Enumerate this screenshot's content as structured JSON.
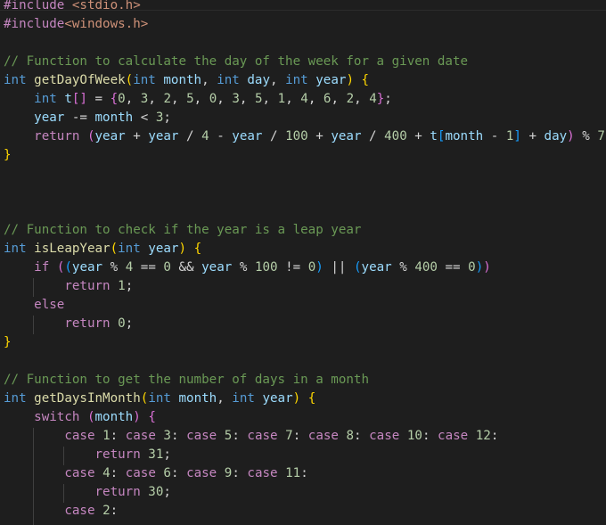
{
  "colors": {
    "background": "#1e1e1e",
    "keyword": "#569cd6",
    "control": "#c586c0",
    "function": "#dcdcaa",
    "variable": "#9cdcfe",
    "number": "#b5cea8",
    "string": "#ce9178",
    "comment": "#6a9955",
    "text": "#d4d4d4",
    "bracket_gold": "#ffd700",
    "bracket_purple": "#da70d6",
    "bracket_blue": "#179fff"
  },
  "lines": [
    [
      [
        "#include",
        "control"
      ],
      [
        " ",
        "text"
      ],
      [
        "<stdio.h>",
        "string"
      ]
    ],
    [
      [
        "#include",
        "control"
      ],
      [
        "<windows.h>",
        "string"
      ]
    ],
    [],
    [
      [
        "// Function to calculate the day of the week for a given date",
        "comment"
      ]
    ],
    [
      [
        "int",
        "keyword"
      ],
      [
        " ",
        "text"
      ],
      [
        "getDayOfWeek",
        "function"
      ],
      [
        "(",
        "bracket_gold"
      ],
      [
        "int",
        "keyword"
      ],
      [
        " ",
        "text"
      ],
      [
        "month",
        "variable"
      ],
      [
        ", ",
        "text"
      ],
      [
        "int",
        "keyword"
      ],
      [
        " ",
        "text"
      ],
      [
        "day",
        "variable"
      ],
      [
        ", ",
        "text"
      ],
      [
        "int",
        "keyword"
      ],
      [
        " ",
        "text"
      ],
      [
        "year",
        "variable"
      ],
      [
        ")",
        "bracket_gold"
      ],
      [
        " ",
        "text"
      ],
      [
        "{",
        "bracket_gold"
      ]
    ],
    [
      [
        "    ",
        "text"
      ],
      [
        "int",
        "keyword"
      ],
      [
        " ",
        "text"
      ],
      [
        "t",
        "variable"
      ],
      [
        "[]",
        "bracket_purple"
      ],
      [
        " = ",
        "text"
      ],
      [
        "{",
        "bracket_purple"
      ],
      [
        "0",
        "number"
      ],
      [
        ", ",
        "text"
      ],
      [
        "3",
        "number"
      ],
      [
        ", ",
        "text"
      ],
      [
        "2",
        "number"
      ],
      [
        ", ",
        "text"
      ],
      [
        "5",
        "number"
      ],
      [
        ", ",
        "text"
      ],
      [
        "0",
        "number"
      ],
      [
        ", ",
        "text"
      ],
      [
        "3",
        "number"
      ],
      [
        ", ",
        "text"
      ],
      [
        "5",
        "number"
      ],
      [
        ", ",
        "text"
      ],
      [
        "1",
        "number"
      ],
      [
        ", ",
        "text"
      ],
      [
        "4",
        "number"
      ],
      [
        ", ",
        "text"
      ],
      [
        "6",
        "number"
      ],
      [
        ", ",
        "text"
      ],
      [
        "2",
        "number"
      ],
      [
        ", ",
        "text"
      ],
      [
        "4",
        "number"
      ],
      [
        "}",
        "bracket_purple"
      ],
      [
        ";",
        "text"
      ]
    ],
    [
      [
        "    ",
        "text"
      ],
      [
        "year",
        "variable"
      ],
      [
        " -= ",
        "text"
      ],
      [
        "month",
        "variable"
      ],
      [
        " < ",
        "text"
      ],
      [
        "3",
        "number"
      ],
      [
        ";",
        "text"
      ]
    ],
    [
      [
        "    ",
        "text"
      ],
      [
        "return",
        "control"
      ],
      [
        " ",
        "text"
      ],
      [
        "(",
        "bracket_purple"
      ],
      [
        "year",
        "variable"
      ],
      [
        " + ",
        "text"
      ],
      [
        "year",
        "variable"
      ],
      [
        " / ",
        "text"
      ],
      [
        "4",
        "number"
      ],
      [
        " - ",
        "text"
      ],
      [
        "year",
        "variable"
      ],
      [
        " / ",
        "text"
      ],
      [
        "100",
        "number"
      ],
      [
        " + ",
        "text"
      ],
      [
        "year",
        "variable"
      ],
      [
        " / ",
        "text"
      ],
      [
        "400",
        "number"
      ],
      [
        " + ",
        "text"
      ],
      [
        "t",
        "variable"
      ],
      [
        "[",
        "bracket_blue"
      ],
      [
        "month",
        "variable"
      ],
      [
        " - ",
        "text"
      ],
      [
        "1",
        "number"
      ],
      [
        "]",
        "bracket_blue"
      ],
      [
        " + ",
        "text"
      ],
      [
        "day",
        "variable"
      ],
      [
        ")",
        "bracket_purple"
      ],
      [
        " % ",
        "text"
      ],
      [
        "7",
        "number"
      ],
      [
        ";",
        "text"
      ]
    ],
    [
      [
        "}",
        "bracket_gold"
      ]
    ],
    [],
    [],
    [],
    [
      [
        "// Function to check if the year is a leap year",
        "comment"
      ]
    ],
    [
      [
        "int",
        "keyword"
      ],
      [
        " ",
        "text"
      ],
      [
        "isLeapYear",
        "function"
      ],
      [
        "(",
        "bracket_gold"
      ],
      [
        "int",
        "keyword"
      ],
      [
        " ",
        "text"
      ],
      [
        "year",
        "variable"
      ],
      [
        ")",
        "bracket_gold"
      ],
      [
        " ",
        "text"
      ],
      [
        "{",
        "bracket_gold"
      ]
    ],
    [
      [
        "    ",
        "text"
      ],
      [
        "if",
        "control"
      ],
      [
        " ",
        "text"
      ],
      [
        "(",
        "bracket_purple"
      ],
      [
        "(",
        "bracket_blue"
      ],
      [
        "year",
        "variable"
      ],
      [
        " % ",
        "text"
      ],
      [
        "4",
        "number"
      ],
      [
        " == ",
        "text"
      ],
      [
        "0",
        "number"
      ],
      [
        " && ",
        "text"
      ],
      [
        "year",
        "variable"
      ],
      [
        " % ",
        "text"
      ],
      [
        "100",
        "number"
      ],
      [
        " != ",
        "text"
      ],
      [
        "0",
        "number"
      ],
      [
        ")",
        "bracket_blue"
      ],
      [
        " || ",
        "text"
      ],
      [
        "(",
        "bracket_blue"
      ],
      [
        "year",
        "variable"
      ],
      [
        " % ",
        "text"
      ],
      [
        "400",
        "number"
      ],
      [
        " == ",
        "text"
      ],
      [
        "0",
        "number"
      ],
      [
        ")",
        "bracket_blue"
      ],
      [
        ")",
        "bracket_purple"
      ]
    ],
    [
      [
        "        ",
        "text"
      ],
      [
        "return",
        "control"
      ],
      [
        " ",
        "text"
      ],
      [
        "1",
        "number"
      ],
      [
        ";",
        "text"
      ]
    ],
    [
      [
        "    ",
        "text"
      ],
      [
        "else",
        "control"
      ]
    ],
    [
      [
        "        ",
        "text"
      ],
      [
        "return",
        "control"
      ],
      [
        " ",
        "text"
      ],
      [
        "0",
        "number"
      ],
      [
        ";",
        "text"
      ]
    ],
    [
      [
        "}",
        "bracket_gold"
      ]
    ],
    [],
    [
      [
        "// Function to get the number of days in a month",
        "comment"
      ]
    ],
    [
      [
        "int",
        "keyword"
      ],
      [
        " ",
        "text"
      ],
      [
        "getDaysInMonth",
        "function"
      ],
      [
        "(",
        "bracket_gold"
      ],
      [
        "int",
        "keyword"
      ],
      [
        " ",
        "text"
      ],
      [
        "month",
        "variable"
      ],
      [
        ", ",
        "text"
      ],
      [
        "int",
        "keyword"
      ],
      [
        " ",
        "text"
      ],
      [
        "year",
        "variable"
      ],
      [
        ")",
        "bracket_gold"
      ],
      [
        " ",
        "text"
      ],
      [
        "{",
        "bracket_gold"
      ]
    ],
    [
      [
        "    ",
        "text"
      ],
      [
        "switch",
        "control"
      ],
      [
        " ",
        "text"
      ],
      [
        "(",
        "bracket_purple"
      ],
      [
        "month",
        "variable"
      ],
      [
        ")",
        "bracket_purple"
      ],
      [
        " ",
        "text"
      ],
      [
        "{",
        "bracket_purple"
      ]
    ],
    [
      [
        "        ",
        "text"
      ],
      [
        "case",
        "control"
      ],
      [
        " ",
        "text"
      ],
      [
        "1",
        "number"
      ],
      [
        ": ",
        "text"
      ],
      [
        "case",
        "control"
      ],
      [
        " ",
        "text"
      ],
      [
        "3",
        "number"
      ],
      [
        ": ",
        "text"
      ],
      [
        "case",
        "control"
      ],
      [
        " ",
        "text"
      ],
      [
        "5",
        "number"
      ],
      [
        ": ",
        "text"
      ],
      [
        "case",
        "control"
      ],
      [
        " ",
        "text"
      ],
      [
        "7",
        "number"
      ],
      [
        ": ",
        "text"
      ],
      [
        "case",
        "control"
      ],
      [
        " ",
        "text"
      ],
      [
        "8",
        "number"
      ],
      [
        ": ",
        "text"
      ],
      [
        "case",
        "control"
      ],
      [
        " ",
        "text"
      ],
      [
        "10",
        "number"
      ],
      [
        ": ",
        "text"
      ],
      [
        "case",
        "control"
      ],
      [
        " ",
        "text"
      ],
      [
        "12",
        "number"
      ],
      [
        ":",
        "text"
      ]
    ],
    [
      [
        "            ",
        "text"
      ],
      [
        "return",
        "control"
      ],
      [
        " ",
        "text"
      ],
      [
        "31",
        "number"
      ],
      [
        ";",
        "text"
      ]
    ],
    [
      [
        "        ",
        "text"
      ],
      [
        "case",
        "control"
      ],
      [
        " ",
        "text"
      ],
      [
        "4",
        "number"
      ],
      [
        ": ",
        "text"
      ],
      [
        "case",
        "control"
      ],
      [
        " ",
        "text"
      ],
      [
        "6",
        "number"
      ],
      [
        ": ",
        "text"
      ],
      [
        "case",
        "control"
      ],
      [
        " ",
        "text"
      ],
      [
        "9",
        "number"
      ],
      [
        ": ",
        "text"
      ],
      [
        "case",
        "control"
      ],
      [
        " ",
        "text"
      ],
      [
        "11",
        "number"
      ],
      [
        ":",
        "text"
      ]
    ],
    [
      [
        "            ",
        "text"
      ],
      [
        "return",
        "control"
      ],
      [
        " ",
        "text"
      ],
      [
        "30",
        "number"
      ],
      [
        ";",
        "text"
      ]
    ],
    [
      [
        "        ",
        "text"
      ],
      [
        "case",
        "control"
      ],
      [
        " ",
        "text"
      ],
      [
        "2",
        "number"
      ],
      [
        ":",
        "text"
      ]
    ]
  ]
}
